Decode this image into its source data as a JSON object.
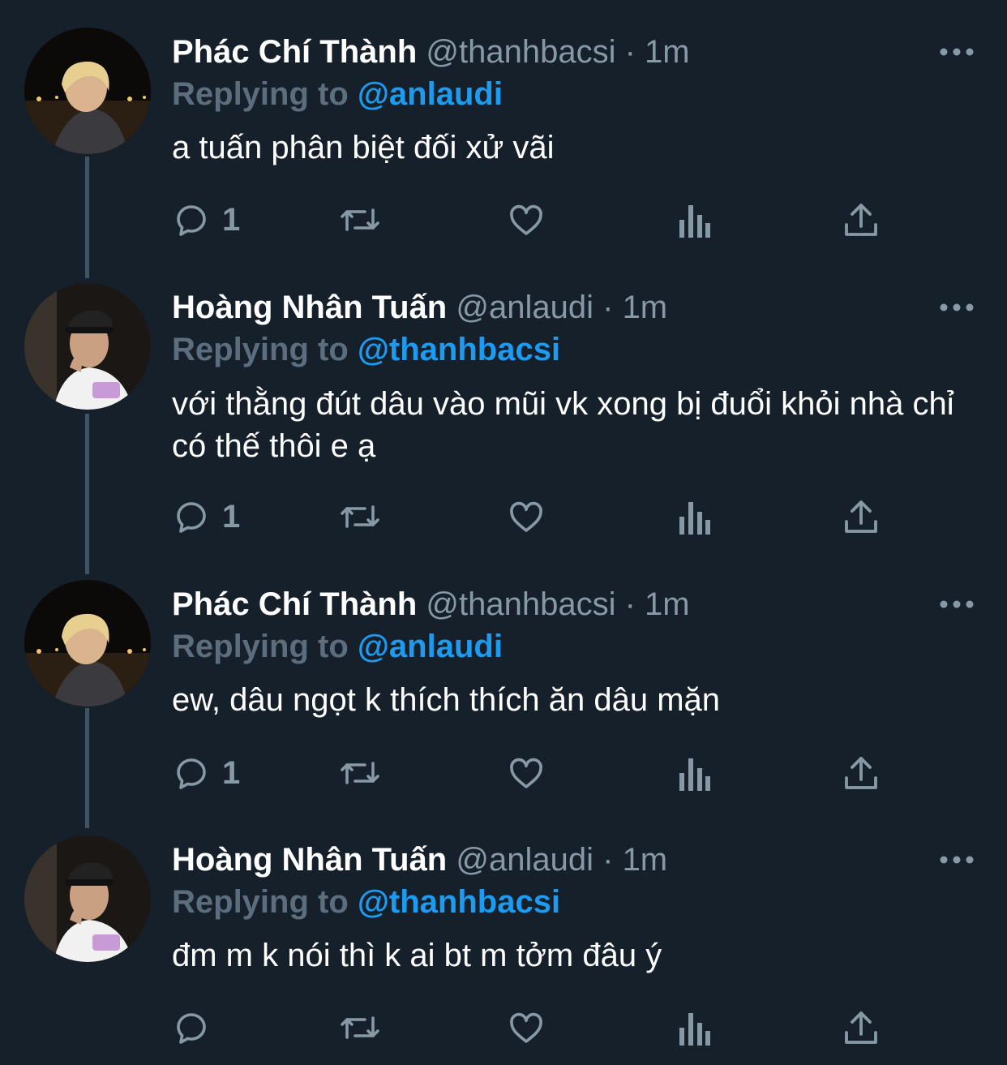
{
  "theme": {
    "background": "#15202b",
    "text": "#ffffff",
    "muted": "#8899a6",
    "accent": "#1d9bf0",
    "thread_line": "#3d5466"
  },
  "tweets": [
    {
      "display_name": "Phác Chí Thành",
      "handle": "@thanhbacsi",
      "separator": "·",
      "time": "1m",
      "replying_label": "Replying to",
      "replying_to": "@anlaudi",
      "text": "a tuấn phân biệt đối xử vãi",
      "reply_count": "1",
      "avatar": "avatar-blonde-night"
    },
    {
      "display_name": "Hoàng Nhân Tuấn",
      "handle": "@anlaudi",
      "separator": "·",
      "time": "1m",
      "replying_label": "Replying to",
      "replying_to": "@thanhbacsi",
      "text": "với thằng đút dâu vào mũi vk xong bị đuổi khỏi nhà chỉ có thế thôi e ạ",
      "reply_count": "1",
      "avatar": "avatar-cap-white-tee"
    },
    {
      "display_name": "Phác Chí Thành",
      "handle": "@thanhbacsi",
      "separator": "·",
      "time": "1m",
      "replying_label": "Replying to",
      "replying_to": "@anlaudi",
      "text": "ew, dâu ngọt k thích thích ăn dâu mặn",
      "reply_count": "1",
      "avatar": "avatar-blonde-night"
    },
    {
      "display_name": "Hoàng Nhân Tuấn",
      "handle": "@anlaudi",
      "separator": "·",
      "time": "1m",
      "replying_label": "Replying to",
      "replying_to": "@thanhbacsi",
      "text": "đm m k nói thì k ai bt m tởm đâu ý",
      "reply_count": "",
      "avatar": "avatar-cap-white-tee"
    }
  ],
  "icons": {
    "reply": "reply-icon",
    "retweet": "retweet-icon",
    "like": "like-icon",
    "analytics": "analytics-icon",
    "share": "share-icon",
    "more": "more-icon"
  }
}
